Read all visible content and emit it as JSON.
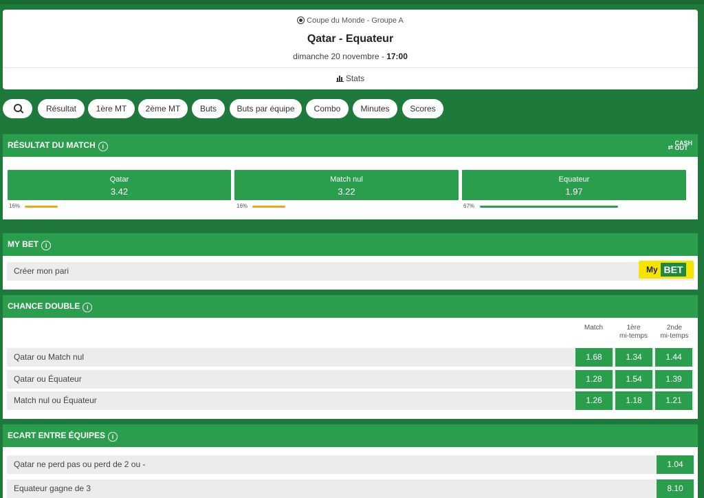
{
  "event": {
    "competition": "Coupe du Monde - Groupe A",
    "title": "Qatar - Equateur",
    "date_prefix": "dimanche 20 novembre - ",
    "time": "17:00",
    "stats_label": "Stats"
  },
  "filters": [
    "Résultat",
    "1ère MT",
    "2ème MT",
    "Buts",
    "Buts par équipe",
    "Combo",
    "Minutes",
    "Scores"
  ],
  "resultat": {
    "title": "RÉSULTAT DU MATCH",
    "cashout_label": [
      "CASH",
      "OUT"
    ],
    "outcomes": [
      {
        "label": "Qatar",
        "odd": "3.42",
        "pct_text": "16%",
        "pct": 16,
        "bar_color": "#f0a418"
      },
      {
        "label": "Match nul",
        "odd": "3.22",
        "pct_text": "16%",
        "pct": 16,
        "bar_color": "#f0a418"
      },
      {
        "label": "Equateur",
        "odd": "1.97",
        "pct_text": "67%",
        "pct": 67,
        "bar_color": "#2a9e4c"
      }
    ]
  },
  "mybet": {
    "title": "MY BET",
    "row_label": "Créer mon pari",
    "logo_my": "My",
    "logo_bet": "BET"
  },
  "chance_double": {
    "title": "CHANCE DOUBLE",
    "headers": [
      {
        "line1": "",
        "line2": "Match"
      },
      {
        "line1": "1ère",
        "line2": "mi-temps"
      },
      {
        "line1": "2nde",
        "line2": "mi-temps"
      }
    ],
    "rows": [
      {
        "label": "Qatar ou Match nul",
        "odds": [
          "1.68",
          "1.34",
          "1.44"
        ]
      },
      {
        "label": "Qatar ou Équateur",
        "odds": [
          "1.28",
          "1.54",
          "1.39"
        ]
      },
      {
        "label": "Match nul ou Équateur",
        "odds": [
          "1.26",
          "1.18",
          "1.21"
        ]
      }
    ]
  },
  "ecart": {
    "title": "ECART ENTRE ÉQUIPES",
    "rows": [
      {
        "label": "Qatar ne perd pas ou perd de 2 ou -",
        "odd": "1.04"
      },
      {
        "label": "Equateur gagne de 3",
        "odd": "8.10"
      }
    ]
  }
}
